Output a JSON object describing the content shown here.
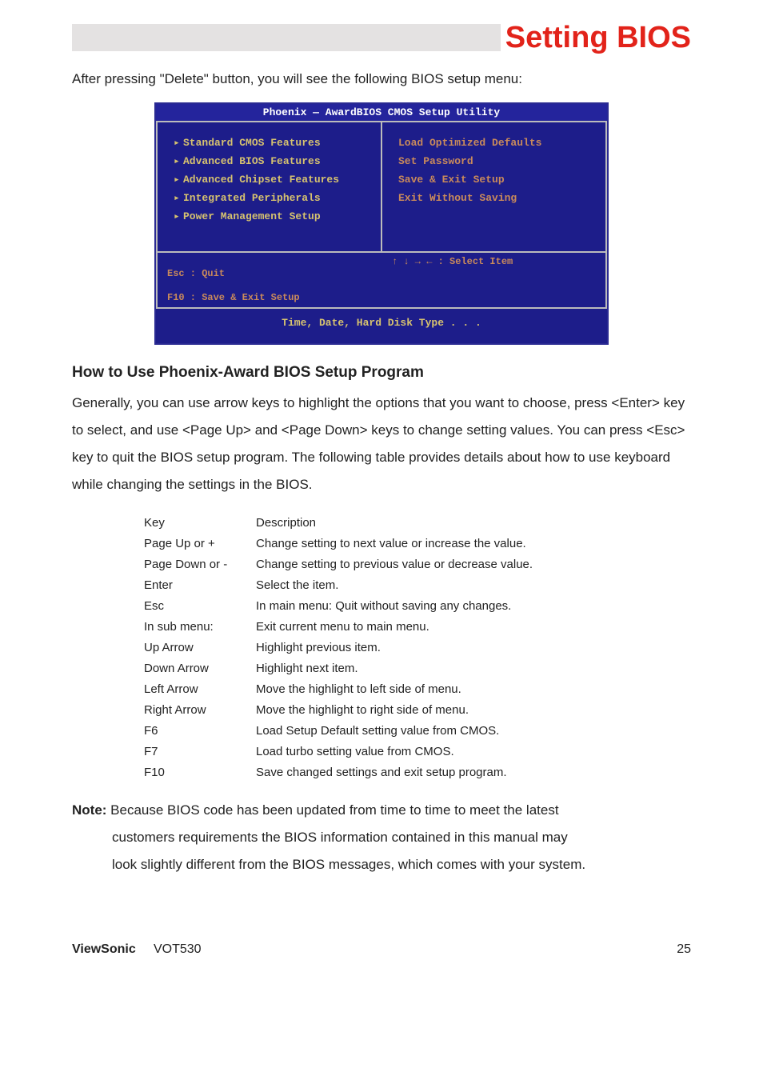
{
  "header": {
    "title": "Setting BIOS"
  },
  "intro": "After pressing \"Delete\" button, you will see the following BIOS setup menu:",
  "bios": {
    "title": "Phoenix — AwardBIOS CMOS Setup Utility",
    "left": [
      "Standard CMOS Features",
      "Advanced BIOS Features",
      "Advanced Chipset Features",
      "Integrated Peripherals",
      "Power Management Setup"
    ],
    "right": [
      "Load Optimized Defaults",
      "Set Password",
      "Save & Exit Setup",
      "Exit Without Saving"
    ],
    "foot_left_1": "Esc : Quit",
    "foot_left_2": "F10 : Save & Exit Setup",
    "foot_right": "↑ ↓ → ←    : Select Item",
    "foot_bottom": "Time, Date, Hard Disk Type . . ."
  },
  "section_heading": "How to Use Phoenix-Award BIOS Setup Program",
  "body_para": "Generally, you can use arrow keys to highlight the options that you want to choose, press <Enter> key to select, and use <Page Up> and <Page Down> keys to change setting values. You can press <Esc> key to quit the BIOS setup program. The following table provides details about how to use keyboard while changing the settings in the BIOS.",
  "table": {
    "header": {
      "k": "Key",
      "d": "Description"
    },
    "rows": [
      {
        "k": "Page Up or +",
        "d": "Change setting to next value or increase the value."
      },
      {
        "k": "Page Down or -",
        "d": "Change setting to previous value or decrease value."
      },
      {
        "k": "Enter",
        "d": "Select the item."
      },
      {
        "k": "Esc",
        "d": "In main menu: Quit without saving any changes."
      },
      {
        "k": "In sub menu:",
        "d": "Exit current menu to main menu."
      },
      {
        "k": "Up Arrow",
        "d": "Highlight previous item."
      },
      {
        "k": "Down Arrow",
        "d": "Highlight next item."
      },
      {
        "k": "Left Arrow",
        "d": "Move the highlight to left side of menu."
      },
      {
        "k": "Right Arrow",
        "d": "Move the highlight to right side of menu."
      },
      {
        "k": "F6",
        "d": "Load Setup Default setting value from CMOS."
      },
      {
        "k": "F7",
        "d": "Load turbo setting value from CMOS."
      },
      {
        "k": "F10",
        "d": "Save changed settings and exit setup program."
      }
    ]
  },
  "note": {
    "label": "Note:",
    "l1": " Because BIOS code has been updated from time to time to meet the latest",
    "l2": "customers requirements the BIOS information contained in this manual may",
    "l3": "look slightly different from the BIOS messages, which comes with your system."
  },
  "footer": {
    "brand": "ViewSonic",
    "model": "VOT530",
    "page": "25"
  }
}
